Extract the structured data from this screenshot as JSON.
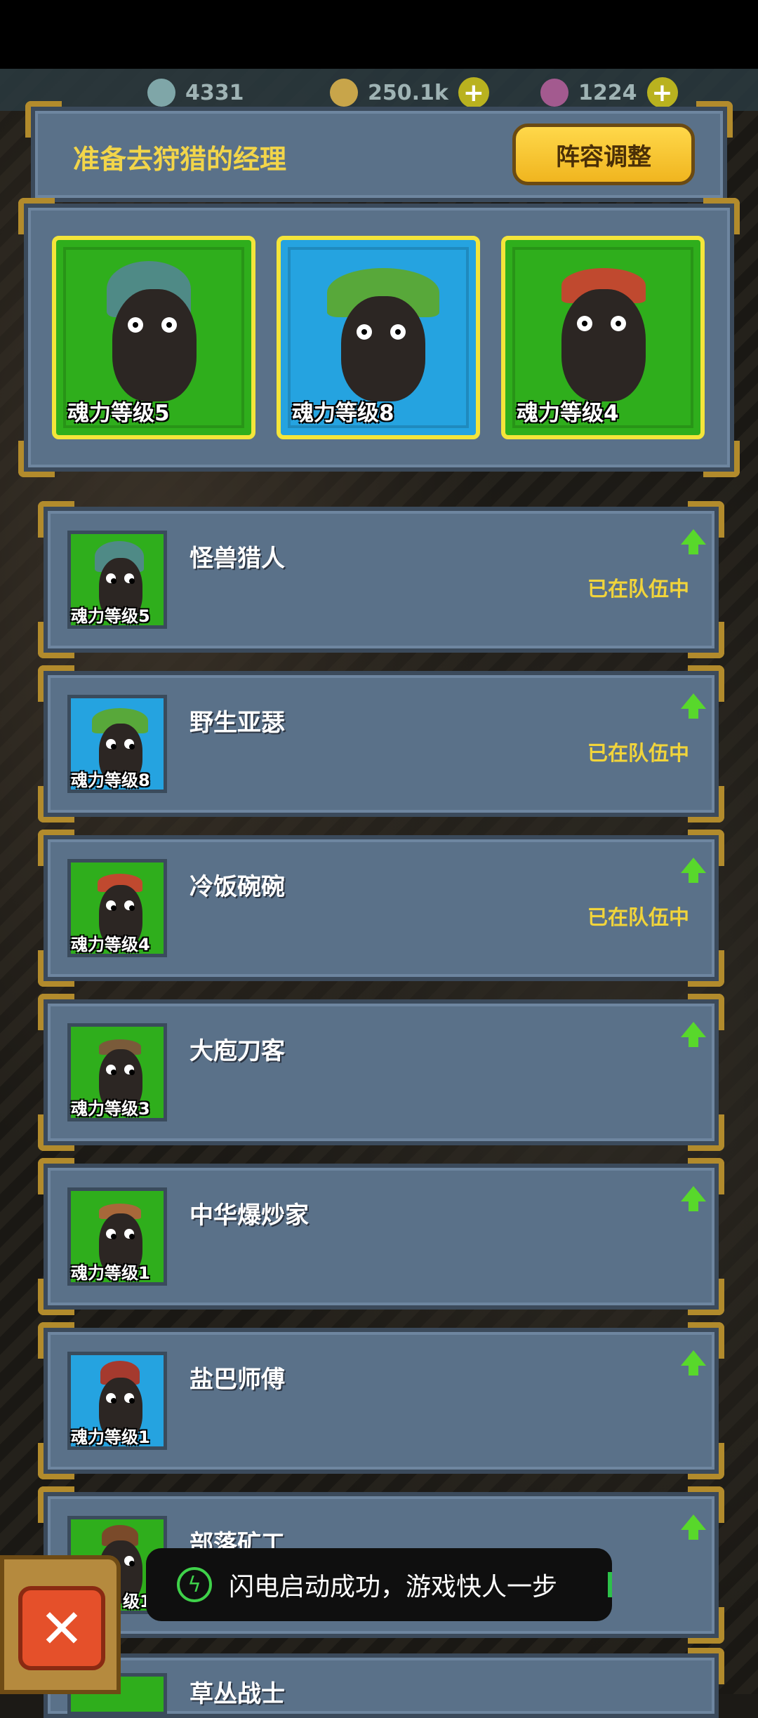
{
  "resources": [
    {
      "icon": "eyeball-icon",
      "value": "4331"
    },
    {
      "icon": "coin-icon",
      "value": "250.1k"
    },
    {
      "icon": "potion-icon",
      "value": "1224"
    }
  ],
  "team": {
    "title": "准备去狩猎的经理",
    "adjust_label": "阵容调整",
    "slots": [
      {
        "level": "魂力等级5",
        "color": "green"
      },
      {
        "level": "魂力等级8",
        "color": "blue"
      },
      {
        "level": "魂力等级4",
        "color": "green"
      }
    ]
  },
  "roster": [
    {
      "name": "怪兽猎人",
      "level": "魂力等级5",
      "status": "已在队伍中",
      "color": "green"
    },
    {
      "name": "野生亚瑟",
      "level": "魂力等级8",
      "status": "已在队伍中",
      "color": "blue"
    },
    {
      "name": "冷饭碗碗",
      "level": "魂力等级4",
      "status": "已在队伍中",
      "color": "green"
    },
    {
      "name": "大庖刀客",
      "level": "魂力等级3",
      "status": "",
      "color": "green"
    },
    {
      "name": "中华爆炒家",
      "level": "魂力等级1",
      "status": "",
      "color": "green"
    },
    {
      "name": "盐巴师傅",
      "level": "魂力等级1",
      "status": "",
      "color": "blue"
    },
    {
      "name": "部落矿工",
      "level": "级1",
      "status": "",
      "color": "green"
    },
    {
      "name": "草丛战士",
      "level": "",
      "status": "",
      "color": "green"
    }
  ],
  "toast": {
    "text": "闪电启动成功，游戏快人一步"
  },
  "close": {
    "symbol": "✕"
  }
}
